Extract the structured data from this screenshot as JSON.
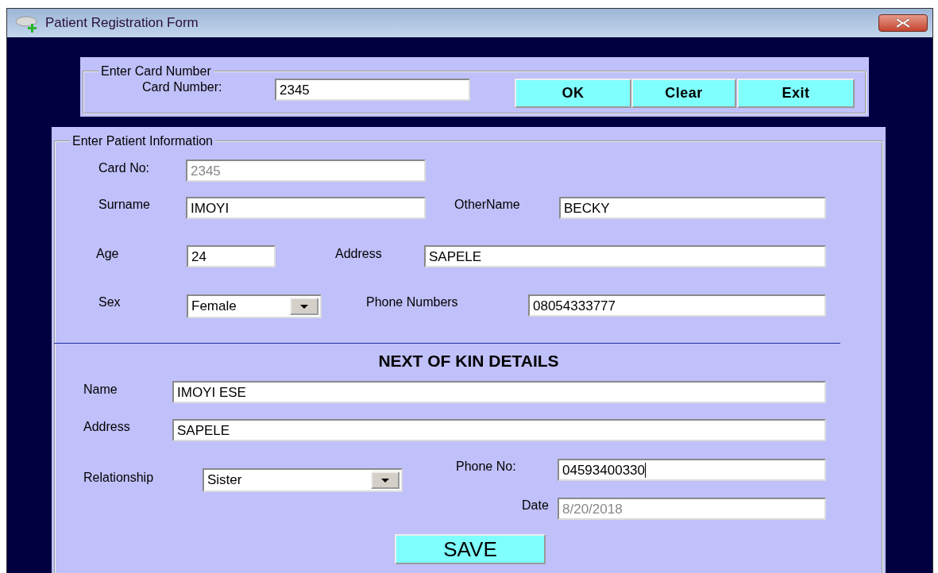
{
  "window": {
    "title": "Patient Registration Form"
  },
  "card_frame": {
    "legend": "Enter Card Number",
    "label": "Card Number:",
    "value": "2345",
    "buttons": [
      "OK",
      "Clear",
      "Exit"
    ]
  },
  "patient_frame": {
    "legend": "Enter Patient Information",
    "fields": [
      {
        "kind": "text",
        "label": "Card No:",
        "value": "2345",
        "disabled": true,
        "focused": false
      },
      {
        "kind": "text",
        "label": "Surname",
        "value": "IMOYI",
        "disabled": false,
        "focused": false
      },
      {
        "kind": "text",
        "label": "OtherName",
        "value": "BECKY",
        "disabled": false,
        "focused": false
      },
      {
        "kind": "text",
        "label": "Age",
        "value": "24",
        "disabled": false,
        "focused": false
      },
      {
        "kind": "text",
        "label": "Address",
        "value": "SAPELE",
        "disabled": false,
        "focused": false
      },
      {
        "kind": "select",
        "label": "Sex",
        "value": "Female",
        "disabled": false,
        "focused": false
      },
      {
        "kind": "text",
        "label": "Phone Numbers",
        "value": "08054333777",
        "disabled": false,
        "focused": false
      }
    ],
    "next_of_kin": {
      "heading": "NEXT OF KIN DETAILS",
      "fields": [
        {
          "kind": "text",
          "label": "Name",
          "value": "IMOYI ESE",
          "disabled": false,
          "focused": false
        },
        {
          "kind": "text",
          "label": "Address",
          "value": "SAPELE",
          "disabled": false,
          "focused": false
        },
        {
          "kind": "select",
          "label": "Relationship",
          "value": "Sister",
          "disabled": false,
          "focused": false
        },
        {
          "kind": "text",
          "label": "Phone No:",
          "value": "04593400330",
          "disabled": false,
          "focused": true
        },
        {
          "kind": "text",
          "label": "Date",
          "value": "8/20/2018",
          "disabled": true,
          "focused": false
        }
      ]
    },
    "save_button": "SAVE"
  }
}
